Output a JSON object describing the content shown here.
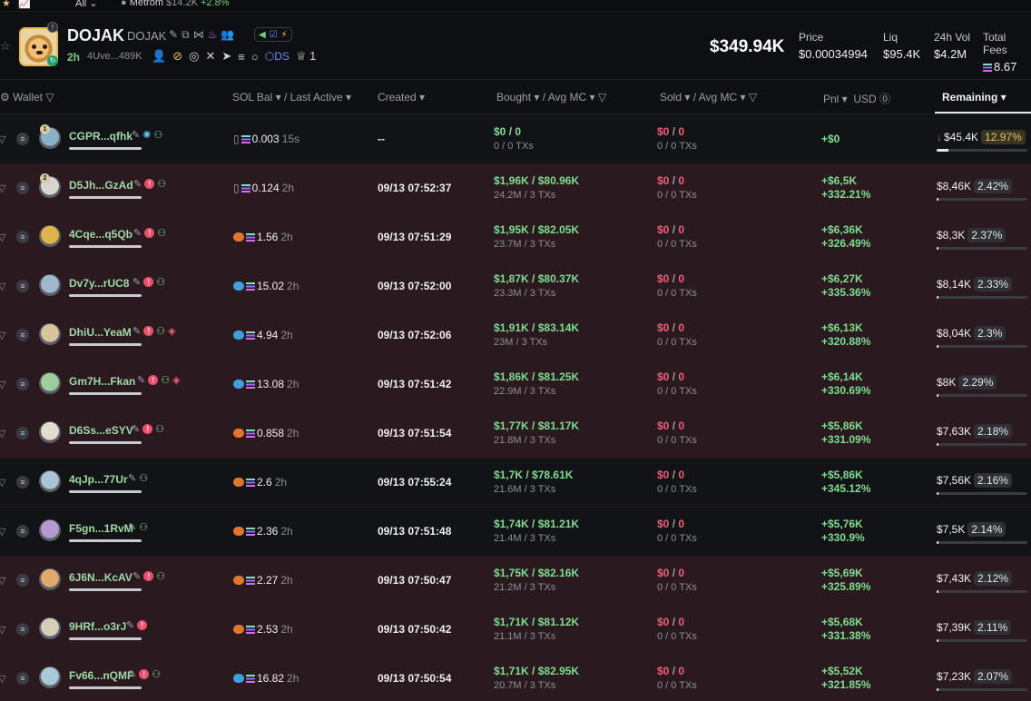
{
  "topbar": {
    "filter": "All",
    "ticker_name": "Metrom",
    "ticker_value": "$14.2K",
    "ticker_change": "+2.8%"
  },
  "token": {
    "name": "DOJAK",
    "symbol": "DOJAK",
    "age": "2h",
    "address": "4Uve...489K",
    "ds_label": "DS",
    "holders_count": "1",
    "market_cap": "$349.94K",
    "stats": [
      {
        "label": "Price",
        "value": "$0.00034994"
      },
      {
        "label": "Liq",
        "value": "$95.4K"
      },
      {
        "label": "24h Vol",
        "value": "$4.2M"
      },
      {
        "label": "Total Fees",
        "value": "8.67"
      }
    ]
  },
  "columns": {
    "wallet": "Wallet",
    "sol_bal": "SOL Bal",
    "last_active": "Last Active",
    "created": "Created",
    "bought": "Bought",
    "bought_avg": "Avg MC",
    "sold": "Sold",
    "sold_avg": "Avg MC",
    "pnl": "Pnl",
    "usd": "USD",
    "remaining": "Remaining"
  },
  "rows": [
    {
      "rank": "1",
      "wallet": "CGPR...qfhk",
      "red": false,
      "layers": false,
      "sol_icon": "none",
      "sol_bal": "0.003",
      "last_active": "15s",
      "created": "--",
      "bought": "$0",
      "bought_avg": "0",
      "bought_sub": "0 / 0 TXs",
      "sold": "$0",
      "sold_avg": "0",
      "sold_sub": "0 / 0 TXs",
      "pnl": "+$0",
      "pnl_pct": "",
      "remaining": "$45.4K",
      "remaining_pct": "12.97%",
      "remaining_fraction": 0.13,
      "bg": "dark",
      "down": true,
      "avatar": "#8ab0c8"
    },
    {
      "rank": "2",
      "wallet": "D5Jh...GzAd",
      "red": true,
      "layers": false,
      "sol_icon": "none",
      "sol_bal": "0.124",
      "last_active": "2h",
      "created": "09/13 07:52:37",
      "bought": "$1,96K",
      "bought_avg": "$80.96K",
      "bought_sub": "24.2M / 3 TXs",
      "sold": "$0",
      "sold_avg": "0",
      "sold_sub": "0 / 0 TXs",
      "pnl": "+$6,5K",
      "pnl_pct": "+332.21%",
      "remaining": "$8,46K",
      "remaining_pct": "2.42%",
      "remaining_fraction": 0.02,
      "bg": "red",
      "down": false,
      "avatar": "#d9d6cf"
    },
    {
      "rank": "",
      "wallet": "4Cqe...q5Qb",
      "red": true,
      "layers": false,
      "sol_icon": "orange",
      "sol_bal": "1.56",
      "last_active": "2h",
      "created": "09/13 07:51:29",
      "bought": "$1,95K",
      "bought_avg": "$82.05K",
      "bought_sub": "23.7M / 3 TXs",
      "sold": "$0",
      "sold_avg": "0",
      "sold_sub": "0 / 0 TXs",
      "pnl": "+$6,36K",
      "pnl_pct": "+326.49%",
      "remaining": "$8,3K",
      "remaining_pct": "2.37%",
      "remaining_fraction": 0.02,
      "bg": "red",
      "down": false,
      "avatar": "#e0b44a"
    },
    {
      "rank": "",
      "wallet": "Dv7y...rUC8",
      "red": true,
      "layers": false,
      "sol_icon": "blue",
      "sol_bal": "15.02",
      "last_active": "2h",
      "created": "09/13 07:52:00",
      "bought": "$1,87K",
      "bought_avg": "$80.37K",
      "bought_sub": "23.3M / 3 TXs",
      "sold": "$0",
      "sold_avg": "0",
      "sold_sub": "0 / 0 TXs",
      "pnl": "+$6,27K",
      "pnl_pct": "+335.36%",
      "remaining": "$8,14K",
      "remaining_pct": "2.33%",
      "remaining_fraction": 0.02,
      "bg": "red",
      "down": false,
      "avatar": "#9fb8d0"
    },
    {
      "rank": "",
      "wallet": "DhiU...YeaM",
      "red": true,
      "layers": true,
      "sol_icon": "blue",
      "sol_bal": "4.94",
      "last_active": "2h",
      "created": "09/13 07:52:06",
      "bought": "$1,91K",
      "bought_avg": "$83.14K",
      "bought_sub": "23M / 3 TXs",
      "sold": "$0",
      "sold_avg": "0",
      "sold_sub": "0 / 0 TXs",
      "pnl": "+$6,13K",
      "pnl_pct": "+320.88%",
      "remaining": "$8,04K",
      "remaining_pct": "2.3%",
      "remaining_fraction": 0.02,
      "bg": "red",
      "down": false,
      "avatar": "#d8c39a"
    },
    {
      "rank": "",
      "wallet": "Gm7H...Fkan",
      "red": true,
      "layers": true,
      "sol_icon": "blue",
      "sol_bal": "13.08",
      "last_active": "2h",
      "created": "09/13 07:51:42",
      "bought": "$1,86K",
      "bought_avg": "$81.25K",
      "bought_sub": "22.9M / 3 TXs",
      "sold": "$0",
      "sold_avg": "0",
      "sold_sub": "0 / 0 TXs",
      "pnl": "+$6,14K",
      "pnl_pct": "+330.69%",
      "remaining": "$8K",
      "remaining_pct": "2.29%",
      "remaining_fraction": 0.02,
      "bg": "red",
      "down": false,
      "avatar": "#9ccf9a"
    },
    {
      "rank": "",
      "wallet": "D6Ss...eSYV",
      "red": true,
      "layers": false,
      "sol_icon": "orange",
      "sol_bal": "0.858",
      "last_active": "2h",
      "created": "09/13 07:51:54",
      "bought": "$1,77K",
      "bought_avg": "$81.17K",
      "bought_sub": "21.8M / 3 TXs",
      "sold": "$0",
      "sold_avg": "0",
      "sold_sub": "0 / 0 TXs",
      "pnl": "+$5,86K",
      "pnl_pct": "+331.09%",
      "remaining": "$7,63K",
      "remaining_pct": "2.18%",
      "remaining_fraction": 0.02,
      "bg": "red",
      "down": false,
      "avatar": "#e3ddd0"
    },
    {
      "rank": "",
      "wallet": "4qJp...77Ur",
      "red": false,
      "layers": false,
      "sol_icon": "orange",
      "sol_bal": "2.6",
      "last_active": "2h",
      "created": "09/13 07:55:24",
      "bought": "$1,7K",
      "bought_avg": "$78.61K",
      "bought_sub": "21.6M / 3 TXs",
      "sold": "$0",
      "sold_avg": "0",
      "sold_sub": "0 / 0 TXs",
      "pnl": "+$5,86K",
      "pnl_pct": "+345.12%",
      "remaining": "$7,56K",
      "remaining_pct": "2.16%",
      "remaining_fraction": 0.02,
      "bg": "dark",
      "down": false,
      "avatar": "#a9c4d6"
    },
    {
      "rank": "",
      "wallet": "F5gn...1RvM",
      "red": false,
      "layers": false,
      "sol_icon": "orange",
      "sol_bal": "2.36",
      "last_active": "2h",
      "created": "09/13 07:51:48",
      "bought": "$1,74K",
      "bought_avg": "$81.21K",
      "bought_sub": "21.4M / 3 TXs",
      "sold": "$0",
      "sold_avg": "0",
      "sold_sub": "0 / 0 TXs",
      "pnl": "+$5,76K",
      "pnl_pct": "+330.9%",
      "remaining": "$7,5K",
      "remaining_pct": "2.14%",
      "remaining_fraction": 0.02,
      "bg": "dark",
      "down": false,
      "avatar": "#b49ad0"
    },
    {
      "rank": "",
      "wallet": "6J6N...KcAV",
      "red": true,
      "layers": false,
      "sol_icon": "orange",
      "sol_bal": "2.27",
      "last_active": "2h",
      "created": "09/13 07:50:47",
      "bought": "$1,75K",
      "bought_avg": "$82.16K",
      "bought_sub": "21.2M / 3 TXs",
      "sold": "$0",
      "sold_avg": "0",
      "sold_sub": "0 / 0 TXs",
      "pnl": "+$5,69K",
      "pnl_pct": "+325.89%",
      "remaining": "$7,43K",
      "remaining_pct": "2.12%",
      "remaining_fraction": 0.02,
      "bg": "red",
      "down": false,
      "avatar": "#e0a86a"
    },
    {
      "rank": "",
      "wallet": "9HRf...o3rJ",
      "red": true,
      "layers": false,
      "sol_icon": "orange",
      "sol_bal": "2.53",
      "last_active": "2h",
      "created": "09/13 07:50:42",
      "bought": "$1,71K",
      "bought_avg": "$81.12K",
      "bought_sub": "21.1M / 3 TXs",
      "sold": "$0",
      "sold_avg": "0",
      "sold_sub": "0 / 0 TXs",
      "pnl": "+$5,68K",
      "pnl_pct": "+331.38%",
      "remaining": "$7,39K",
      "remaining_pct": "2.11%",
      "remaining_fraction": 0.02,
      "bg": "red",
      "down": false,
      "avatar": "#d6cdb8"
    },
    {
      "rank": "",
      "wallet": "Fv66...nQMF",
      "red": true,
      "layers": false,
      "sol_icon": "blue",
      "sol_bal": "16.82",
      "last_active": "2h",
      "created": "09/13 07:50:54",
      "bought": "$1,71K",
      "bought_avg": "$82.95K",
      "bought_sub": "20.7M / 3 TXs",
      "sold": "$0",
      "sold_avg": "0",
      "sold_sub": "0 / 0 TXs",
      "pnl": "+$5,52K",
      "pnl_pct": "+321.85%",
      "remaining": "$7,23K",
      "remaining_pct": "2.07%",
      "remaining_fraction": 0.02,
      "bg": "red",
      "down": false,
      "avatar": "#aac8da"
    }
  ]
}
